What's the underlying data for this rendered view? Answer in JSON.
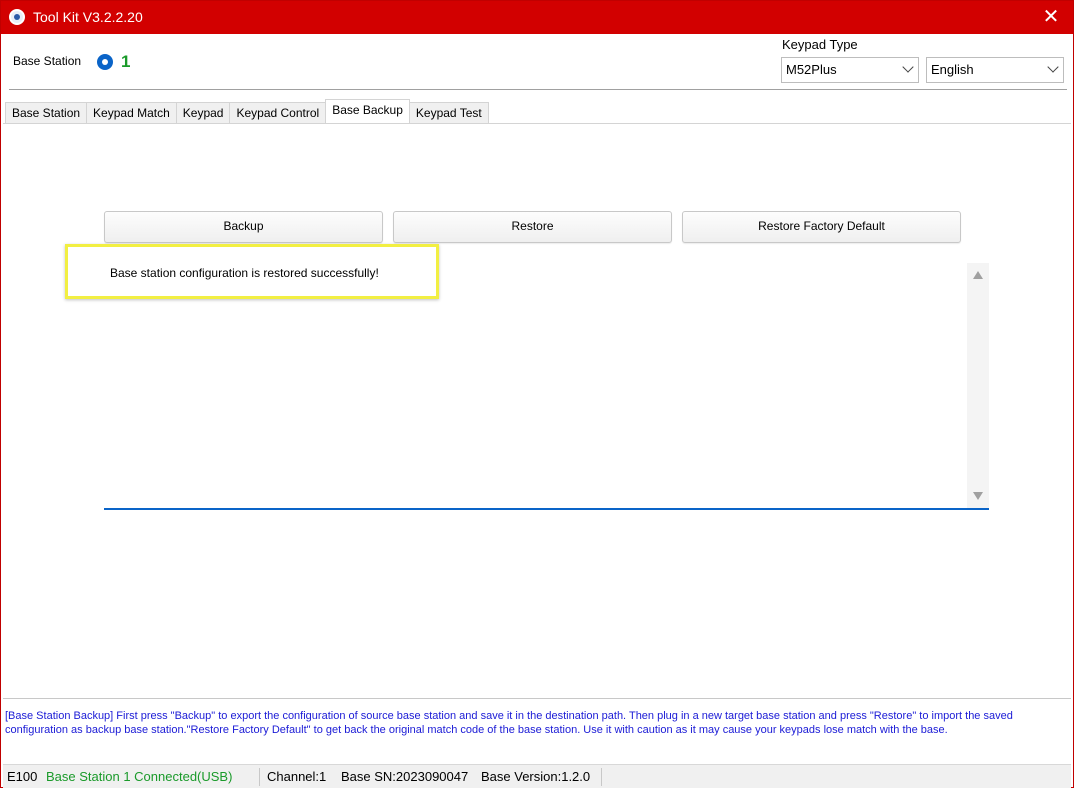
{
  "window": {
    "title": "Tool Kit  V3.2.2.20",
    "close_glyph": "✕"
  },
  "header": {
    "base_station_label": "Base Station",
    "base_station_number": "1",
    "keypad_type_label": "Keypad Type",
    "keypad_type_value": "M52Plus",
    "language_value": "English"
  },
  "tabs": [
    {
      "label": "Base Station",
      "active": false
    },
    {
      "label": "Keypad Match",
      "active": false
    },
    {
      "label": "Keypad",
      "active": false
    },
    {
      "label": "Keypad Control",
      "active": false
    },
    {
      "label": "Base Backup",
      "active": true
    },
    {
      "label": "Keypad Test",
      "active": false
    }
  ],
  "actions": {
    "backup": "Backup",
    "restore": "Restore",
    "factory_default": "Restore Factory Default"
  },
  "output": {
    "message": "Base station configuration is restored successfully!"
  },
  "help_text": "[Base Station Backup] First press \"Backup\" to export the configuration of source base station and save it in the destination path. Then plug in a new target base station and press \"Restore\" to import the saved configuration as backup base station.\"Restore Factory Default\" to get back the original match code of the base station. Use it with caution as it may cause your keypads lose match with the base.",
  "status": {
    "model": "E100",
    "connection": "Base Station 1 Connected(USB)",
    "channel": "Channel:1",
    "serial": "Base SN:2023090047",
    "version": "Base Version:1.2.0"
  },
  "colors": {
    "titlebar": "#d20000",
    "accent_blue": "#0a64c8",
    "connected_green": "#1a9a2a",
    "help_blue": "#1b1bd6",
    "highlight_yellow": "#f2ef42"
  }
}
